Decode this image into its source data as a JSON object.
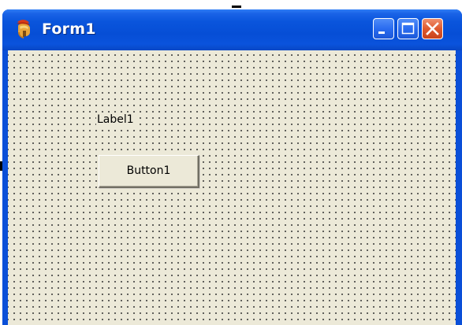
{
  "window": {
    "title": "Form1",
    "controls": {
      "minimize": "minimize-icon",
      "maximize": "maximize-icon",
      "close": "close-icon"
    },
    "app_icon": "spartan-helmet-icon"
  },
  "form": {
    "label_text": "Label1",
    "button_text": "Button1",
    "grid": "dotted design grid"
  },
  "colors": {
    "titlebar": "#0a55dc",
    "client": "#ece9d8",
    "close_button": "#e05a2e"
  }
}
